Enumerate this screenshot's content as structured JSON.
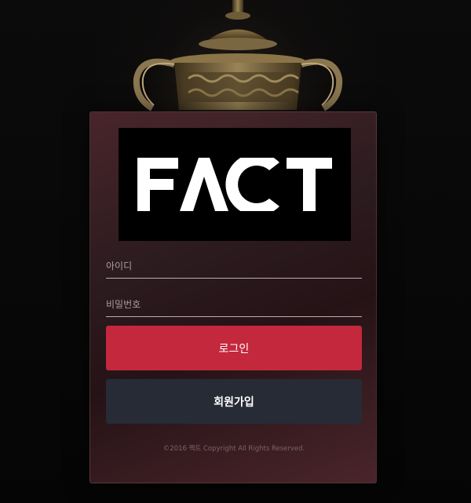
{
  "brand": {
    "logo_text": "FACT",
    "logo_bg_color": "#000000",
    "logo_fg_color": "#ffffff"
  },
  "login_form": {
    "username_placeholder": "아이디",
    "username_value": "",
    "password_placeholder": "비밀번호",
    "password_value": "",
    "login_label": "로그인",
    "signup_label": "회원가입",
    "login_color": "#c4283d",
    "signup_color": "#272b35"
  },
  "footer": {
    "copyright": "©2016 팩트 Copyright All Rights Reserved."
  },
  "background": {
    "image": "trophy-icon"
  }
}
